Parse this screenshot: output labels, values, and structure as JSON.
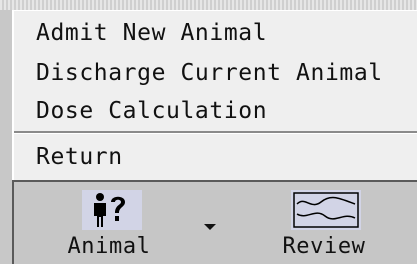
{
  "menu": {
    "items": [
      {
        "label": "Admit New Animal"
      },
      {
        "label": "Discharge Current Animal"
      },
      {
        "label": "Dose Calculation"
      }
    ],
    "return_label": "Return"
  },
  "toolbar": {
    "tools": [
      {
        "label": "Animal",
        "icon": "person-question-icon"
      },
      {
        "label": "Review",
        "icon": "waveform-review-icon"
      }
    ]
  }
}
